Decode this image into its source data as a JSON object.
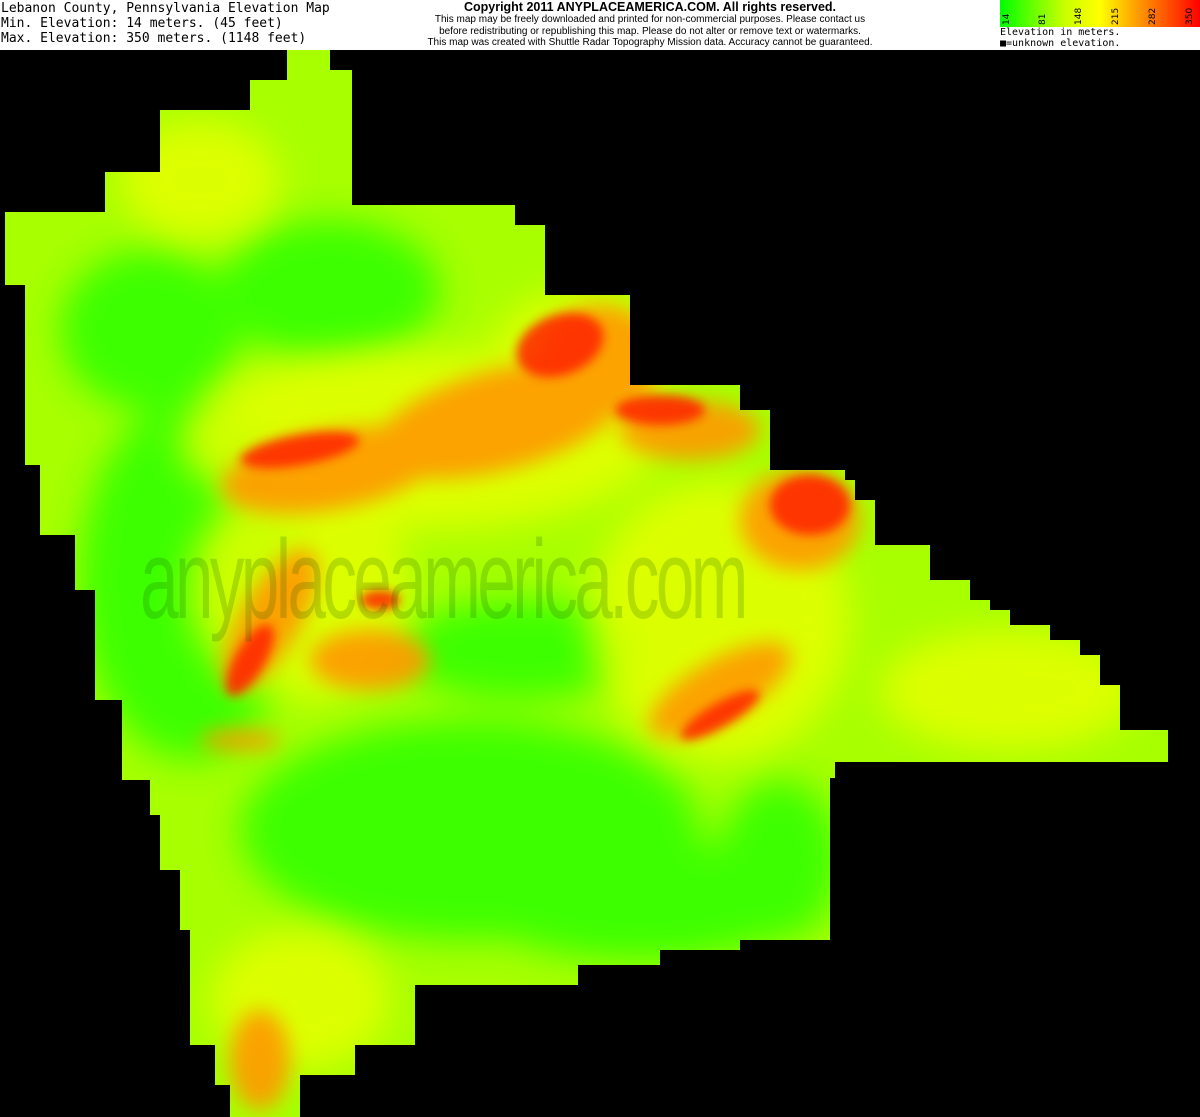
{
  "header": {
    "title": "Lebanon County, Pennsylvania Elevation Map",
    "min_elevation": "Min. Elevation: 14 meters. (45 feet)",
    "max_elevation": "Max. Elevation: 350 meters. (1148 feet)"
  },
  "copyright": {
    "line1": "Copyright 2011 ANYPLACEAMERICA.COM.  All rights reserved.",
    "line2": "This map may be freely downloaded and printed for non-commercial purposes.  Please contact us",
    "line3": "before redistributing or republishing this map.  Please do not alter or remove text or watermarks.",
    "line4": "This map was created with Shuttle Radar Topography Mission data.  Accuracy cannot be guaranteed."
  },
  "legend": {
    "ticks": [
      "14",
      "81",
      "148",
      "215",
      "282",
      "350"
    ],
    "label": "Elevation in meters.",
    "unknown": "■=unknown elevation.",
    "colors": [
      "#00ff00",
      "#80ff00",
      "#ffff00",
      "#ff8000",
      "#ff0000"
    ]
  },
  "watermark": "anyplaceamerica.com",
  "colors": {
    "background": "#000000",
    "low": "#22ff00",
    "mid": "#ccff00",
    "high": "#ff2a00"
  }
}
